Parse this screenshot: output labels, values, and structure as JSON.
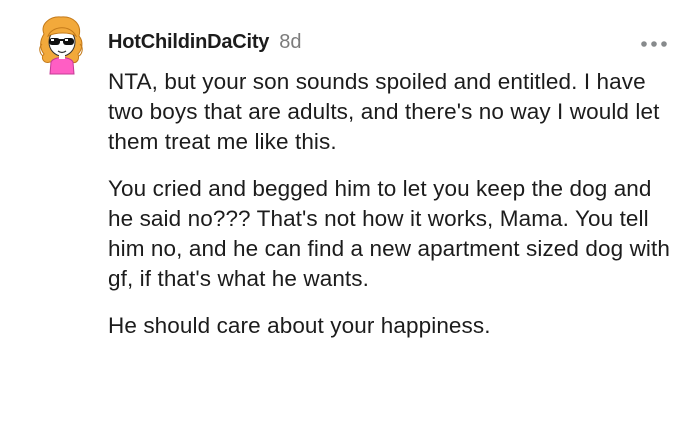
{
  "comment": {
    "username": "HotChildinDaCity",
    "timestamp": "8d",
    "avatar_icon": "sunglasses-girl-avatar-icon",
    "more_icon": "more-options-icon",
    "paragraphs": [
      "NTA, but your son sounds spoiled and entitled. I have two boys that are adults, and there's no way I would let them treat me like this.",
      "You cried and begged him to let you keep the dog and he said no??? That's not how it works, Mama. You tell him no, and he can find a new apartment sized dog with gf, if that's what he wants.",
      "He should care about your happiness."
    ]
  },
  "colors": {
    "username": "#1c1c1c",
    "timestamp": "#7c7c7c",
    "text": "#1c1c1c",
    "background": "#ffffff",
    "avatar_hair": "#f2a93b",
    "avatar_shirt": "#ff5ec4"
  }
}
